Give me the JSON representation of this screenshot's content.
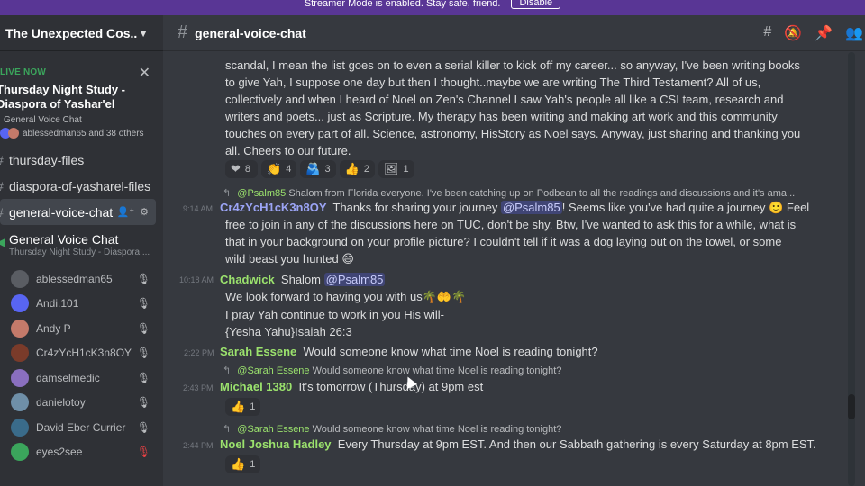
{
  "banner": {
    "message": "Streamer Mode is enabled. Stay safe, friend.",
    "button": "Disable"
  },
  "server": {
    "name": "The Unexpected Cos..."
  },
  "live": {
    "label": "LIVE NOW",
    "title_line1": "Thursday Night Study -",
    "title_line2": "Diaspora of Yashar'el",
    "channel": "General Voice Chat",
    "users": "ablessedman65 and 38 others"
  },
  "channels": [
    {
      "name": "thursday-files"
    },
    {
      "name": "diaspora-of-yasharel-files"
    },
    {
      "name": "general-voice-chat"
    }
  ],
  "voice": {
    "name": "General Voice Chat",
    "status": "Thursday Night Study - Diaspora ..."
  },
  "members": [
    {
      "name": "ablessedman65",
      "color": "#5a5d63"
    },
    {
      "name": "Andi.101",
      "color": "#5865f2"
    },
    {
      "name": "Andy P",
      "color": "#c47a6a"
    },
    {
      "name": "Cr4zYcH1cK3n8OY",
      "color": "#7a3b2a"
    },
    {
      "name": "damselmedic",
      "color": "#8a6fbf"
    },
    {
      "name": "danielotoy",
      "color": "#6f8fa8"
    },
    {
      "name": "David Eber Currier",
      "color": "#3a6b8a"
    },
    {
      "name": "eyes2see",
      "color": "#3ba55c"
    }
  ],
  "chat": {
    "channel": "general-voice-chat",
    "msg1": {
      "lines": [
        "scandal, I mean the list goes on to even a serial killer to kick off my career... so anyway, I've been writing books",
        "to give Yah, I suppose one day but then I thought..maybe we are writing The Third Testament? All of us,",
        "collectively and when I heard of Noel on Zen's Channel I saw Yah's people all like a CSI team, research and",
        "writers and poets... just as Scripture. My therapy has been writing and making art work and this community",
        "touches on every part of all. Science, astronomy, HisStory as Noel says. Anyway, just sharing and thanking you",
        "all. Cheers to our future."
      ],
      "reactions": [
        {
          "emoji": "❤",
          "count": "8"
        },
        {
          "emoji": "👏",
          "count": "4"
        },
        {
          "emoji": "🫂",
          "count": "3"
        },
        {
          "emoji": "👍",
          "count": "2"
        },
        {
          "emoji": "🖼",
          "count": "1"
        }
      ]
    },
    "msg2": {
      "reply_author": "@Psalm85",
      "reply_text": "Shalom from Florida everyone. I've been catching up on Podbean to all the readings and discussions and it's ama...",
      "time": "9:14 AM",
      "author": "Cr4zYcH1cK3n8OY",
      "line1_pre": "Thanks for sharing your journey",
      "mention": "@Psalm85",
      "line1_post": "! Seems like you've had quite a journey 🙂 Feel",
      "lines": [
        "free to join in any of the discussions here on TUC, don't be shy.  Btw, I've wanted to ask this for a while, what is",
        "that in your background on your profile picture?  I couldn't tell if it was a dog laying out on the towel, or some",
        "wild beast you hunted 😄"
      ]
    },
    "msg3": {
      "time": "10:18 AM",
      "author": "Chadwick",
      "pre": "Shalom",
      "mention": "@Psalm85",
      "lines": [
        "We look forward to having you with us🌴🤲🌴",
        "I pray Yah continue to work in you His will-",
        "{Yesha Yahu}Isaiah 26:3"
      ]
    },
    "msg4": {
      "time": "2:22 PM",
      "author": "Sarah Essene",
      "text": "Would someone know what time Noel is reading tonight?"
    },
    "msg5": {
      "reply_author": "@Sarah Essene",
      "reply_text": "Would someone know what time Noel is reading tonight?",
      "time": "2:43 PM",
      "author": "Michael 1380",
      "text": "It's tomorrow (Thursday) at 9pm est",
      "reaction": {
        "emoji": "👍",
        "count": "1"
      }
    },
    "msg6": {
      "reply_author": "@Sarah Essene",
      "reply_text": "Would someone know what time Noel is reading tonight?",
      "time": "2:44 PM",
      "author": "Noel Joshua Hadley",
      "text": "Every Thursday at 9pm EST. And then our Sabbath gathering is every Saturday at 8pm EST.",
      "reaction": {
        "emoji": "👍",
        "count": "1"
      }
    }
  }
}
